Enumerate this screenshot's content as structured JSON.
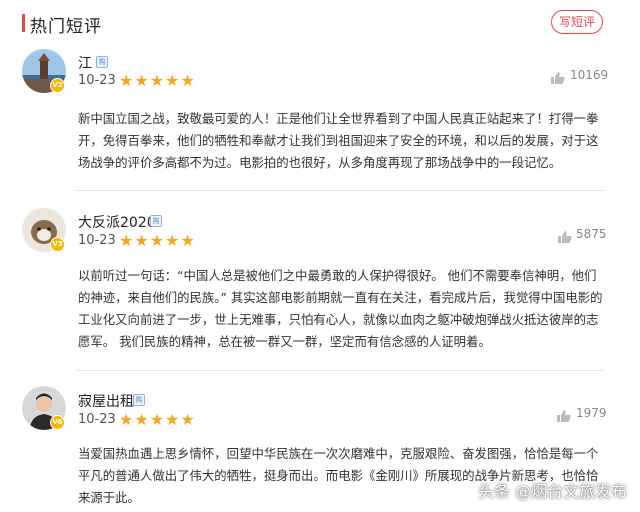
{
  "header": {
    "title": "热门短评",
    "write_button": "写短评",
    "accent_color": "#e8474e"
  },
  "reviews": [
    {
      "username": "江",
      "level": "V2",
      "date": "10-23",
      "rating": 5,
      "likes": "10169",
      "text": "新中国立国之战，致敬最可爱的人！正是他们让全世界看到了中国人民真正站起来了！打得一拳开，免得百拳来，他们的牺牲和奉献才让我们到祖国迎来了安全的环境，和以后的发展，对于这场战争的评价多高都不为过。电影拍的也很好，从多角度再现了那场战争中的一段记忆。"
    },
    {
      "username": "大反派2020",
      "level": "V3",
      "date": "10-23",
      "rating": 5,
      "likes": "5875",
      "text": "以前听过一句话：“中国人总是被他们之中最勇敢的人保护得很好。 他们不需要奉信神明，他们的神迹，来自他们的民族。” 其实这部电影前期就一直有在关注，看完成片后，我觉得中国电影的工业化又向前进了一步，世上无难事，只怕有心人，就像以血肉之躯冲破炮弹战火抵达彼岸的志愿军。 我们民族的精神，总在被一群又一群，坚定而有信念感的人证明着。"
    },
    {
      "username": "寂屋出租",
      "level": "V6",
      "date": "10-23",
      "rating": 5,
      "likes": "1979",
      "text": "当爱国热血遇上思乡情怀，回望中华民族在一次次磨难中，克服艰险、奋发图强，恰恰是每一个平凡的普通人做出了伟大的牺牲，挺身而出。而电影《金刚川》所展现的战争片新思考，也恰恰来源于此。"
    }
  ],
  "watermark": "头条 @烟台文旅发布"
}
